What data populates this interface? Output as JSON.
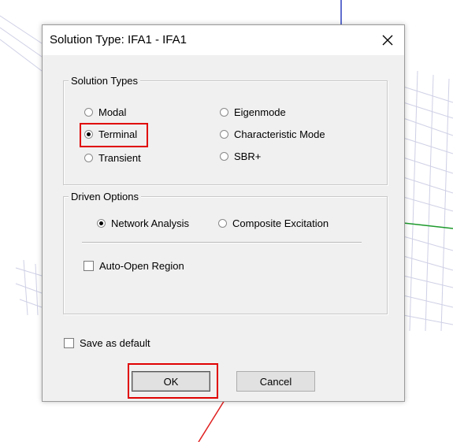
{
  "dialog": {
    "title": "Solution Type: IFA1 - IFA1",
    "close_icon": "close-icon"
  },
  "solution_types": {
    "legend": "Solution Types",
    "options": [
      {
        "label": "Modal",
        "checked": false
      },
      {
        "label": "Terminal",
        "checked": true
      },
      {
        "label": "Transient",
        "checked": false
      },
      {
        "label": "Eigenmode",
        "checked": false
      },
      {
        "label": "Characteristic Mode",
        "checked": false
      },
      {
        "label": "SBR+",
        "checked": false
      }
    ]
  },
  "driven_options": {
    "legend": "Driven Options",
    "options": [
      {
        "label": "Network Analysis",
        "checked": true
      },
      {
        "label": "Composite Excitation",
        "checked": false
      }
    ],
    "auto_open_region": {
      "label": "Auto-Open Region",
      "checked": false
    }
  },
  "save_default": {
    "label": "Save as default",
    "checked": false
  },
  "buttons": {
    "ok": "OK",
    "cancel": "Cancel"
  },
  "colors": {
    "highlight": "#e00000",
    "dialog_bg": "#f0f0f0"
  }
}
